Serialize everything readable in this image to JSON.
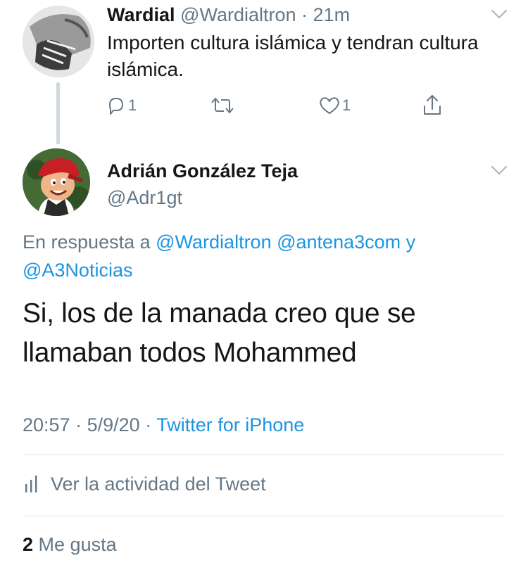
{
  "parent_tweet": {
    "display_name": "Wardial",
    "handle": "@Wardialtron",
    "separator": "·",
    "time": "21m",
    "text": "Importen cultura islámica y tendran cultura islámica.",
    "reply_count": "1",
    "like_count": "1"
  },
  "main_tweet": {
    "display_name": "Adrián González Teja",
    "handle": "@Adr1gt",
    "reply_prefix": "En respuesta a",
    "mentions": [
      "@Wardialtron",
      "@antena3com",
      "@A3Noticias"
    ],
    "mention_joiner": "y",
    "text": "Si, los de la manada creo que se llamaban todos Mohammed",
    "time": "20:57",
    "date": "5/9/20",
    "meta_separator": "·",
    "source": "Twitter for iPhone",
    "activity_label": "Ver la actividad del Tweet",
    "likes_count": "2",
    "likes_label": "Me gusta"
  },
  "icons": {
    "reply": "reply-icon",
    "retweet": "retweet-icon",
    "like": "heart-icon",
    "share": "share-icon",
    "more": "chevron-down-icon",
    "activity": "bar-chart-icon"
  },
  "colors": {
    "link": "#1b95e0",
    "muted": "#657786",
    "text": "#14171a",
    "divider": "#e1e8ed"
  }
}
